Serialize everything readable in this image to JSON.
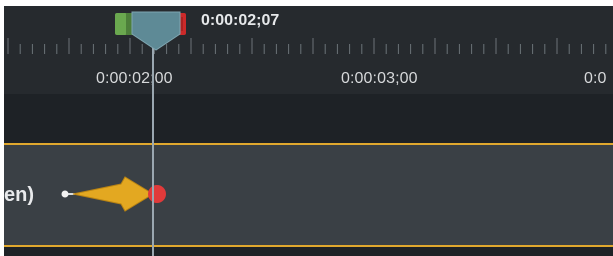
{
  "timeline": {
    "playhead_time": "0:00:02;07",
    "ruler_labels": [
      "0:00:02;00",
      "0:00:03;00",
      "0:0"
    ],
    "clip_label": "en)",
    "colors": {
      "background": "#1e2226",
      "ruler": "#262a2e",
      "track": "#3a4045",
      "track_border": "#e0a82e",
      "playhead": "#5e8a96",
      "arrow": "#e3a821",
      "endpoint": "#e03a3a",
      "start_marker": "#6aa84f",
      "end_marker": "#cc2a2a"
    }
  }
}
